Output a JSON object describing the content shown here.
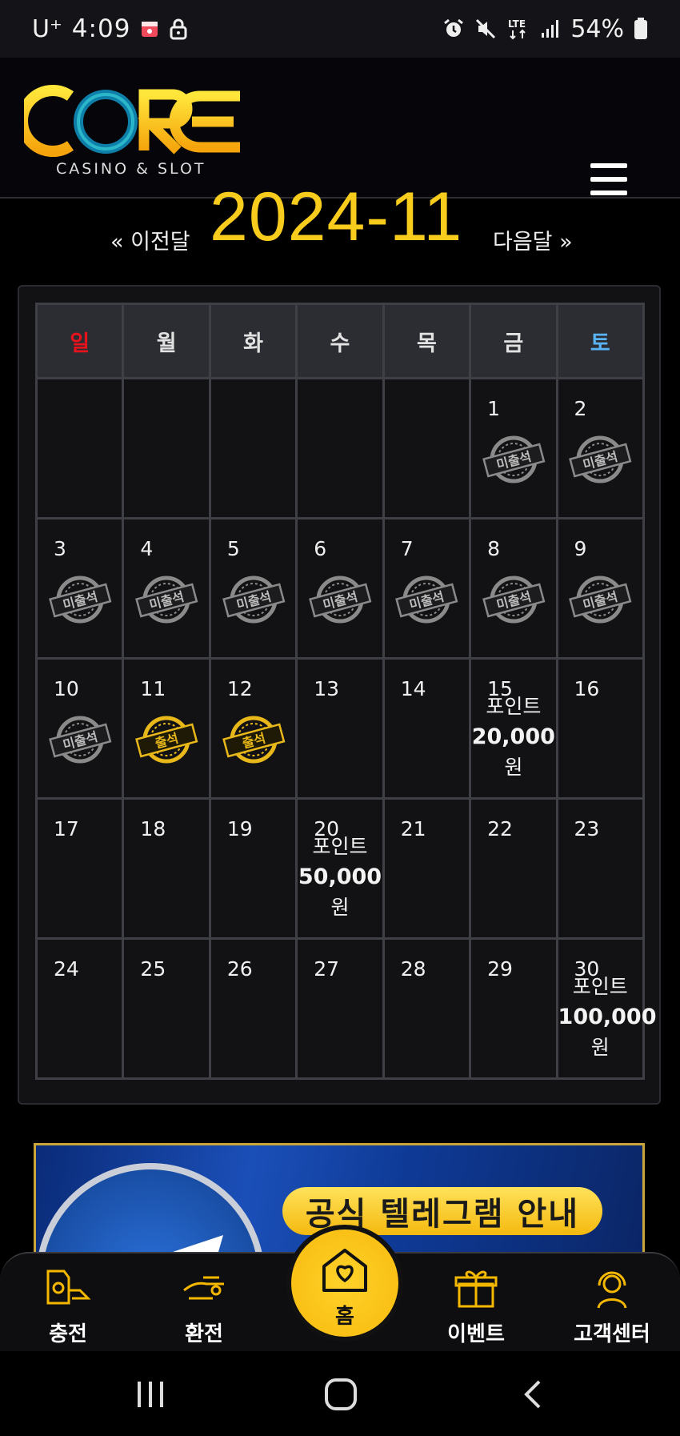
{
  "status_bar": {
    "carrier": "U⁺",
    "time": "4:09",
    "network": "LTE",
    "battery": "54%"
  },
  "brand": {
    "logo_text": "CORE",
    "logo_subtext": "CASINO & SLOT",
    "accent": "#f7cc1c"
  },
  "month_nav": {
    "prev_label": "« 이전달",
    "month": "2024-11",
    "next_label": "다음달 »"
  },
  "calendar": {
    "weekdays": [
      "일",
      "월",
      "화",
      "수",
      "목",
      "금",
      "토"
    ],
    "stamp_missed": "미출석",
    "stamp_attended": "출석",
    "weeks": [
      [
        {
          "day": "",
          "stamp": "",
          "reward": null
        },
        {
          "day": "",
          "stamp": "",
          "reward": null
        },
        {
          "day": "",
          "stamp": "",
          "reward": null
        },
        {
          "day": "",
          "stamp": "",
          "reward": null
        },
        {
          "day": "",
          "stamp": "",
          "reward": null
        },
        {
          "day": "1",
          "stamp": "missed",
          "reward": null
        },
        {
          "day": "2",
          "stamp": "missed",
          "reward": null
        }
      ],
      [
        {
          "day": "3",
          "stamp": "missed",
          "reward": null
        },
        {
          "day": "4",
          "stamp": "missed",
          "reward": null
        },
        {
          "day": "5",
          "stamp": "missed",
          "reward": null
        },
        {
          "day": "6",
          "stamp": "missed",
          "reward": null
        },
        {
          "day": "7",
          "stamp": "missed",
          "reward": null
        },
        {
          "day": "8",
          "stamp": "missed",
          "reward": null
        },
        {
          "day": "9",
          "stamp": "missed",
          "reward": null
        }
      ],
      [
        {
          "day": "10",
          "stamp": "missed",
          "reward": null
        },
        {
          "day": "11",
          "stamp": "attended",
          "reward": null
        },
        {
          "day": "12",
          "stamp": "attended",
          "reward": null
        },
        {
          "day": "13",
          "stamp": "",
          "reward": null
        },
        {
          "day": "14",
          "stamp": "",
          "reward": null
        },
        {
          "day": "15",
          "stamp": "",
          "reward": {
            "label": "포인트",
            "amount": "20,000",
            "unit": "원"
          }
        },
        {
          "day": "16",
          "stamp": "",
          "reward": null
        }
      ],
      [
        {
          "day": "17",
          "stamp": "",
          "reward": null
        },
        {
          "day": "18",
          "stamp": "",
          "reward": null
        },
        {
          "day": "19",
          "stamp": "",
          "reward": null
        },
        {
          "day": "20",
          "stamp": "",
          "reward": {
            "label": "포인트",
            "amount": "50,000",
            "unit": "원"
          }
        },
        {
          "day": "21",
          "stamp": "",
          "reward": null
        },
        {
          "day": "22",
          "stamp": "",
          "reward": null
        },
        {
          "day": "23",
          "stamp": "",
          "reward": null
        }
      ],
      [
        {
          "day": "24",
          "stamp": "",
          "reward": null
        },
        {
          "day": "25",
          "stamp": "",
          "reward": null
        },
        {
          "day": "26",
          "stamp": "",
          "reward": null
        },
        {
          "day": "27",
          "stamp": "",
          "reward": null
        },
        {
          "day": "28",
          "stamp": "",
          "reward": null
        },
        {
          "day": "29",
          "stamp": "",
          "reward": null
        },
        {
          "day": "30",
          "stamp": "",
          "reward": {
            "label": "포인트",
            "amount": "100,000",
            "unit": "원"
          }
        }
      ]
    ]
  },
  "banner": {
    "text": "공식 텔레그램 안내"
  },
  "bottom_nav": {
    "items": [
      {
        "label": "충전",
        "icon": "deposit-icon"
      },
      {
        "label": "환전",
        "icon": "withdraw-icon"
      },
      {
        "label": "홈",
        "icon": "home-heart-icon"
      },
      {
        "label": "이벤트",
        "icon": "gift-icon"
      },
      {
        "label": "고객센터",
        "icon": "support-icon"
      }
    ]
  }
}
